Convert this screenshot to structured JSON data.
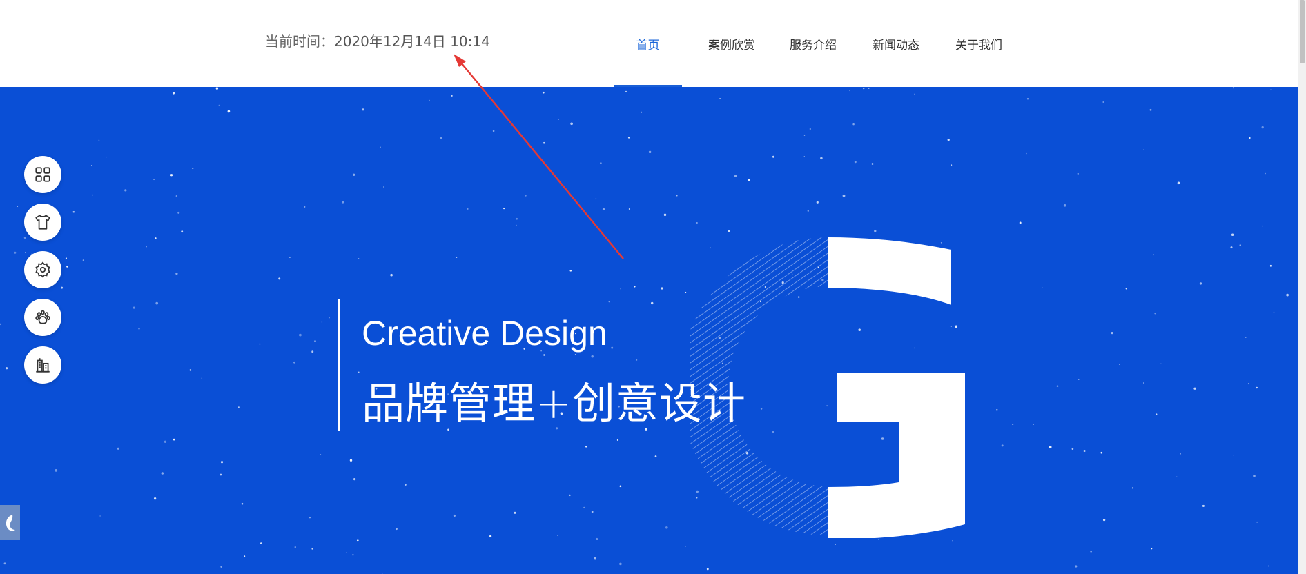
{
  "header": {
    "clock_label": "当前时间：",
    "clock_value": "2020年12月14日 10:14"
  },
  "nav": {
    "items": [
      {
        "label": "首页",
        "active": true
      },
      {
        "label": "案例欣赏",
        "active": false
      },
      {
        "label": "服务介绍",
        "active": false
      },
      {
        "label": "新闻动态",
        "active": false
      },
      {
        "label": "关于我们",
        "active": false
      }
    ]
  },
  "hero": {
    "title_en": "Creative Design",
    "title_cn": "品牌管理+创意设计",
    "background_color": "#0a4fd6",
    "logo_letter": "G"
  },
  "side_toolbar": {
    "icons": [
      "grid-icon",
      "tshirt-icon",
      "gear-icon",
      "paw-icon",
      "building-icon"
    ]
  },
  "corner_widget": {
    "icon": "logo-swirl-icon"
  },
  "annotation": {
    "color": "#e53935"
  }
}
